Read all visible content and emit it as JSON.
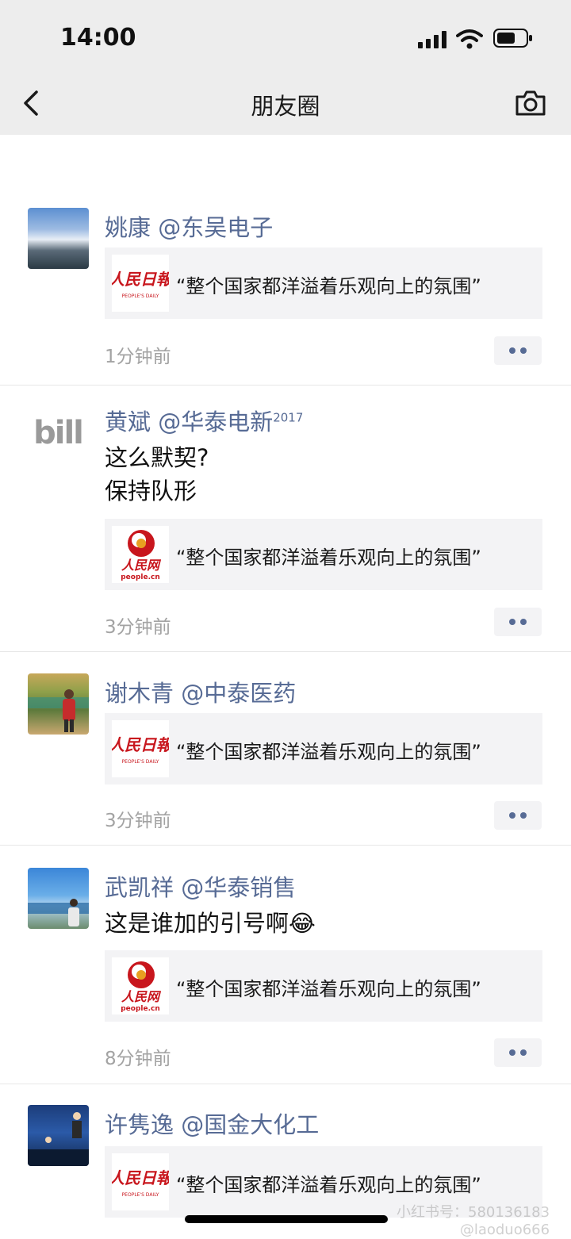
{
  "status_bar": {
    "time": "14:00"
  },
  "nav": {
    "title": "朋友圈"
  },
  "posts": [
    {
      "name": "姚康 @东吴电子",
      "text_lines": [],
      "link": {
        "source_logo": "人民日报 PEOPLE'S DAILY",
        "title": "“整个国家都洋溢着乐观向上的氛围”"
      },
      "time": "1分钟前"
    },
    {
      "name": "黄斌 @华泰电新",
      "name_superscript": "2017",
      "text_lines": [
        "这么默契?",
        "保持队形"
      ],
      "link": {
        "source_logo": "人民网 people.cn",
        "title": "“整个国家都洋溢着乐观向上的氛围”"
      },
      "time": "3分钟前"
    },
    {
      "name": "谢木青 @中泰医药",
      "text_lines": [],
      "link": {
        "source_logo": "人民日报 PEOPLE'S DAILY",
        "title": "“整个国家都洋溢着乐观向上的氛围”"
      },
      "time": "3分钟前"
    },
    {
      "name": "武凯祥 @华泰销售",
      "text_lines": [
        "这是谁加的引号啊😂"
      ],
      "link": {
        "source_logo": "人民网 people.cn",
        "title": "“整个国家都洋溢着乐观向上的氛围”"
      },
      "time": "8分钟前"
    },
    {
      "name": "许隽逸 @国金大化工",
      "text_lines": [],
      "link": {
        "source_logo": "人民日报 PEOPLE'S DAILY",
        "title": "“整个国家都洋溢着乐观向上的氛围”"
      },
      "time": ""
    }
  ],
  "watermark": {
    "line1": "小红书号：580136183",
    "line2": "@laoduo666"
  },
  "colors": {
    "name_blue": "#576b95",
    "bar_gray": "#ededed",
    "card_gray": "#f3f3f5",
    "people_daily_red": "#c8161d"
  }
}
